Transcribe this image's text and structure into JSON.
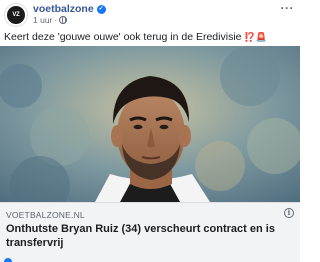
{
  "post": {
    "page_name": "voetbalzone",
    "avatar_text": "VZ",
    "time": "1 uur",
    "dot": "·",
    "text": "Keert deze 'gouwe ouwe' ook terug in de Eredivisie",
    "text_emoji": "⁉️🚨",
    "more_label": "···"
  },
  "link_preview": {
    "domain": "VOETBALZONE.NL",
    "title": "Onthutste Bryan Ruiz (34) verscheurt contract en is transfervrij",
    "info_label": "i"
  },
  "colors": {
    "link_blue": "#385898",
    "verified": "#1877f2",
    "preview_bg": "#f2f3f5"
  }
}
